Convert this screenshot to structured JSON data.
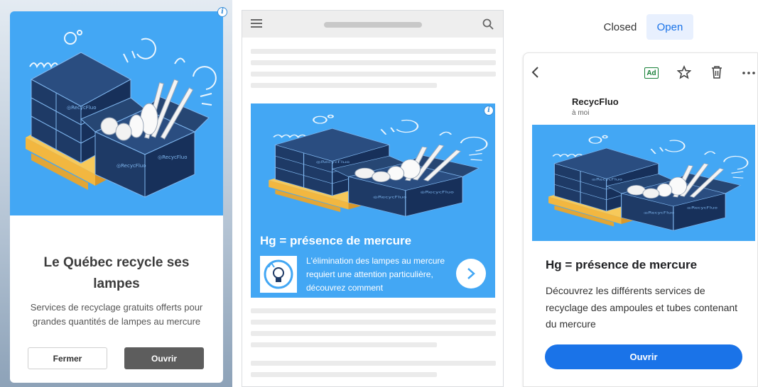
{
  "colors": {
    "illustration_bg": "#43a7f4",
    "box_navy": "#1e3a66",
    "pallet_gold": "#f2b740",
    "gmail_blue": "#1a73e8",
    "ad_green": "#188038",
    "button_gray": "#5d5d5d"
  },
  "interstitial": {
    "info_icon": "info-icon",
    "title": "Le Québec recycle ses lampes",
    "description": "Services de recyclage gratuits offerts pour grandes quantités de lampes au mercure",
    "close_label": "Fermer",
    "open_label": "Ouvrir"
  },
  "browser": {
    "menu_icon": "hamburger-icon",
    "search_icon": "search-icon",
    "banner": {
      "info_icon": "info-icon",
      "headline": "Hg = présence de mercure",
      "body": "L'élimination des lampes au mercure requiert une attention particulière, découvrez comment",
      "arrow_icon": "chevron-right-icon"
    }
  },
  "gmail": {
    "tabs": {
      "closed": "Closed",
      "open": "Open",
      "selected": "Open"
    },
    "toolbar": {
      "ad_badge": "Ad",
      "back_icon": "back-arrow-icon",
      "star_icon": "star-icon",
      "trash_icon": "trash-icon",
      "more_icon": "more-icon"
    },
    "sender": "RecycFluo",
    "recipient": "à moi",
    "headline": "Hg = présence de mercure",
    "body": "Découvrez les différents services de recyclage des ampoules et tubes contenant du mercure",
    "cta_label": "Ouvrir"
  }
}
